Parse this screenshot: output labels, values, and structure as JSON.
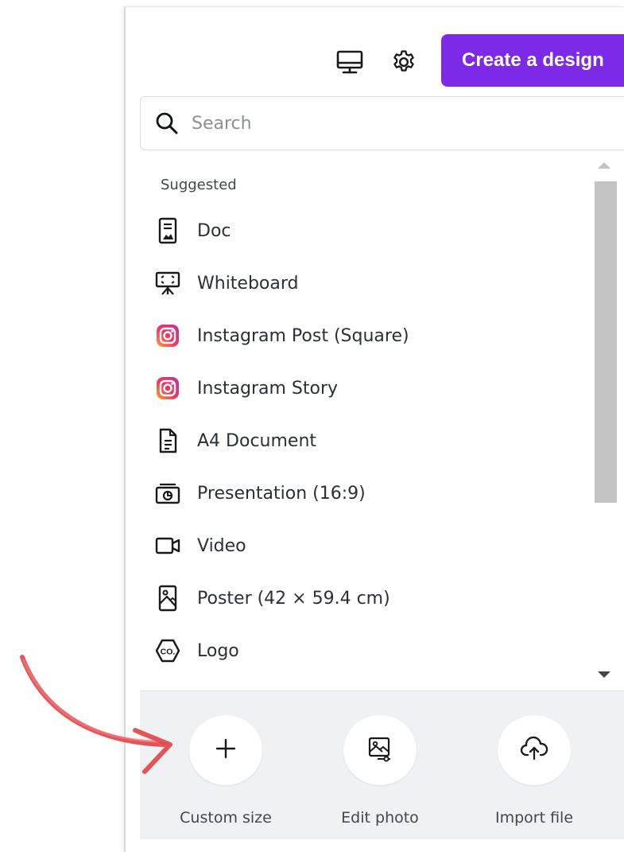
{
  "toolbar": {
    "desktop_icon": "monitor-icon",
    "settings_icon": "gear-icon",
    "create_label": "Create a design",
    "accent": "#7d2ae8"
  },
  "search": {
    "placeholder": "Search",
    "value": ""
  },
  "suggested": {
    "heading": "Suggested",
    "items": [
      {
        "label": "Doc",
        "icon": "doc-icon"
      },
      {
        "label": "Whiteboard",
        "icon": "whiteboard-icon"
      },
      {
        "label": "Instagram Post (Square)",
        "icon": "instagram-icon"
      },
      {
        "label": "Instagram Story",
        "icon": "instagram-icon"
      },
      {
        "label": "A4 Document",
        "icon": "document-icon"
      },
      {
        "label": "Presentation (16:9)",
        "icon": "presentation-icon"
      },
      {
        "label": "Video",
        "icon": "video-icon"
      },
      {
        "label": "Poster (42 × 59.4 cm)",
        "icon": "poster-icon"
      },
      {
        "label": "Logo",
        "icon": "logo-icon"
      }
    ]
  },
  "actions": [
    {
      "label": "Custom size",
      "icon": "plus-icon"
    },
    {
      "label": "Edit photo",
      "icon": "edit-photo-icon"
    },
    {
      "label": "Import file",
      "icon": "cloud-upload-icon"
    }
  ],
  "annotation": {
    "arrow_color": "#e2474c"
  }
}
